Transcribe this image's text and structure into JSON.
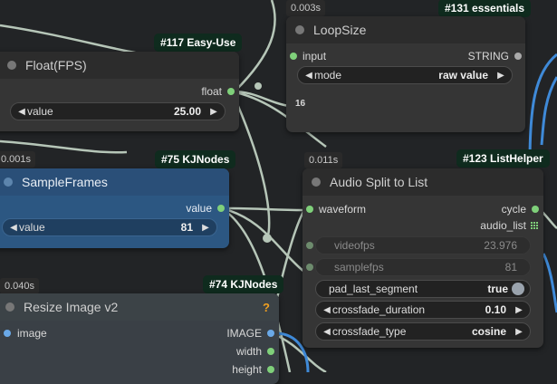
{
  "nodes": {
    "loopsize": {
      "time": "0.003s",
      "tag": "#131 essentials",
      "title": "LoopSize",
      "input_label": "input",
      "output_label": "STRING",
      "mode_label": "mode",
      "mode_value": "raw value",
      "preview": "16"
    },
    "float_fps": {
      "tag": "#117 Easy-Use",
      "title": "Float(FPS)",
      "output_label": "float",
      "value_label": "value",
      "value": "25.00"
    },
    "sampleframes": {
      "time": "0.001s",
      "tag": "#75 KJNodes",
      "title": "SampleFrames",
      "output_label": "value",
      "value_label": "value",
      "value": "81"
    },
    "audio_split": {
      "time": "0.011s",
      "tag": "#123 ListHelper",
      "title": "Audio Split to List",
      "input_label": "waveform",
      "out_cycle": "cycle",
      "out_audio_list": "audio_list",
      "videofps_label": "videofps",
      "videofps_value": "23.976",
      "samplefps_label": "samplefps",
      "samplefps_value": "81",
      "pad_label": "pad_last_segment",
      "pad_value": "true",
      "crossfade_duration_label": "crossfade_duration",
      "crossfade_duration_value": "0.10",
      "crossfade_type_label": "crossfade_type",
      "crossfade_type_value": "cosine"
    },
    "resize": {
      "time": "0.040s",
      "tag": "#74 KJNodes",
      "title": "Resize Image v2",
      "badge": "?",
      "input_label": "image",
      "out_image": "IMAGE",
      "out_width": "width",
      "out_height": "height"
    }
  },
  "icons": {
    "left": "arrow-left-icon",
    "right": "arrow-right-icon",
    "socket": "socket-dot-icon",
    "list": "list-grid-icon"
  },
  "colors": {
    "background": "#222426",
    "wire": "#b6c6b8",
    "blue_wire": "#3f8ad8",
    "green_socket": "#7fd07a",
    "blue_node": "#2c5782"
  }
}
